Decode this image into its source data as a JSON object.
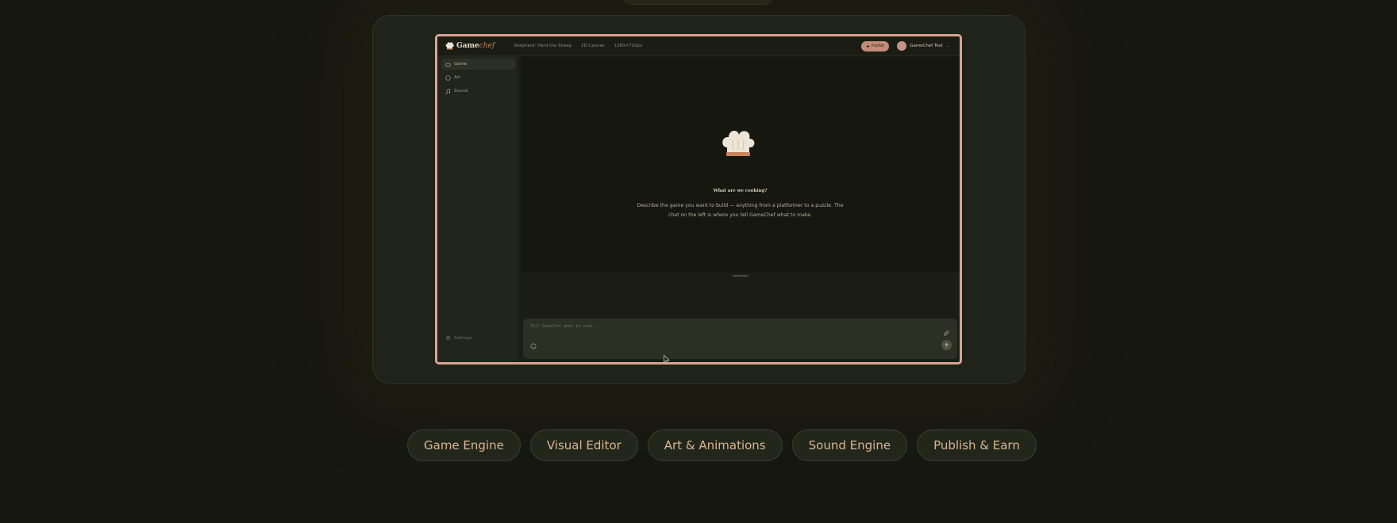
{
  "app": {
    "logo": {
      "word_bold": "Game",
      "word_italic": "chef"
    },
    "breadcrumb": [
      "Shepherd: Herd the Sheep",
      "2D Canvas",
      "1280×720px"
    ],
    "publish_label": "Publish",
    "user_name": "GameChef Test",
    "sidebar": {
      "items": [
        {
          "label": "Game",
          "icon": "gamepad-icon",
          "active": true
        },
        {
          "label": "Art",
          "icon": "palette-icon",
          "active": false
        },
        {
          "label": "Sound",
          "icon": "music-icon",
          "active": false
        }
      ],
      "settings_label": "Settings",
      "collapse_glyph": "‹"
    },
    "preview": {
      "title": "What are we cooking?",
      "description": "Describe the game you want to build — anything from a platformer to a puzzle. The chat on the left is where you tell GameChef what to make."
    },
    "chat": {
      "placeholder": "Tell GameChef what to cook..."
    }
  },
  "features": [
    "Game Engine",
    "Visual Editor",
    "Art & Animations",
    "Sound Engine",
    "Publish & Earn"
  ],
  "colors": {
    "background": "#171812",
    "accent_border": "#d8a592",
    "pill_text": "#d8b693"
  }
}
